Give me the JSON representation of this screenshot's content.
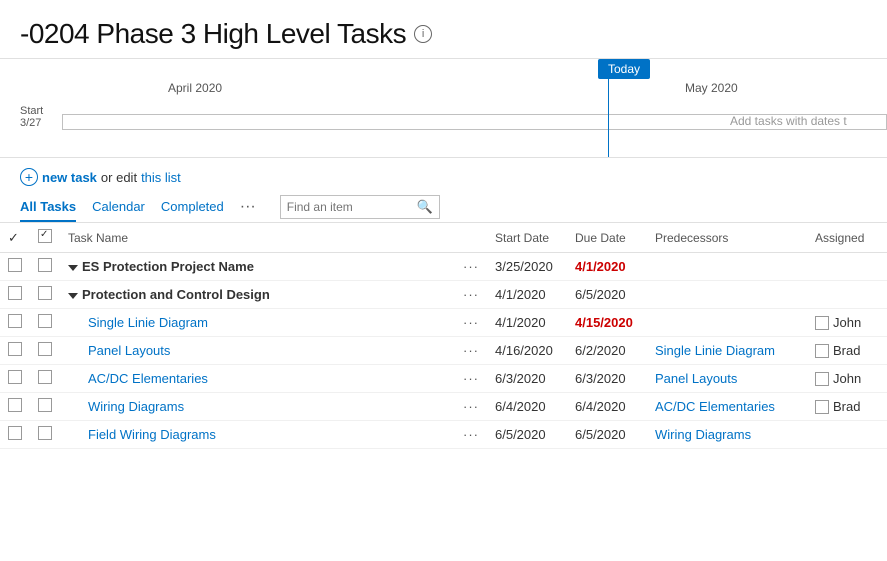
{
  "header": {
    "title": "-0204 Phase 3 High Level Tasks",
    "info_icon": "ⓘ"
  },
  "gantt": {
    "today_label": "Today",
    "april_label": "April 2020",
    "may_label": "May 2020",
    "start_label": "Start",
    "start_date": "3/27",
    "add_tasks_text": "Add tasks with dates t"
  },
  "new_task_bar": {
    "plus": "+",
    "new_task_link": "new task",
    "or_text": " or edit ",
    "edit_link": "this list"
  },
  "tabs": [
    {
      "label": "All Tasks",
      "active": true
    },
    {
      "label": "Calendar",
      "active": false
    },
    {
      "label": "Completed",
      "active": false
    }
  ],
  "tabs_dots": "...",
  "search_placeholder": "Find an item",
  "table": {
    "columns": [
      "",
      "",
      "Task Name",
      "",
      "Start Date",
      "Due Date",
      "Predecessors",
      "Assigned"
    ],
    "rows": [
      {
        "check": "",
        "indent": 1,
        "name": "ES Protection Project Name",
        "name_style": "bold",
        "dots": "···",
        "start": "3/25/2020",
        "start_style": "normal",
        "due": "4/1/2020",
        "due_style": "red",
        "pred": "",
        "assign": ""
      },
      {
        "check": "",
        "indent": 1,
        "name": "Protection and Control Design",
        "name_style": "bold",
        "dots": "···",
        "start": "4/1/2020",
        "start_style": "normal",
        "due": "6/5/2020",
        "due_style": "normal",
        "pred": "",
        "assign": ""
      },
      {
        "check": "",
        "indent": 2,
        "name": "Single Linie Diagram",
        "name_style": "link",
        "dots": "···",
        "start": "4/1/2020",
        "start_style": "normal",
        "due": "4/15/2020",
        "due_style": "red",
        "pred": "",
        "assign": "John"
      },
      {
        "check": "",
        "indent": 2,
        "name": "Panel Layouts",
        "name_style": "link",
        "dots": "···",
        "start": "4/16/2020",
        "start_style": "normal",
        "due": "6/2/2020",
        "due_style": "normal",
        "pred": "Single Linie Diagram",
        "assign": "Brad"
      },
      {
        "check": "",
        "indent": 2,
        "name": "AC/DC Elementaries",
        "name_style": "link",
        "dots": "···",
        "start": "6/3/2020",
        "start_style": "normal",
        "due": "6/3/2020",
        "due_style": "normal",
        "pred": "Panel Layouts",
        "assign": "John"
      },
      {
        "check": "",
        "indent": 2,
        "name": "Wiring Diagrams",
        "name_style": "link",
        "dots": "···",
        "start": "6/4/2020",
        "start_style": "normal",
        "due": "6/4/2020",
        "due_style": "normal",
        "pred": "AC/DC Elementaries",
        "assign": "Brad"
      },
      {
        "check": "",
        "indent": 2,
        "name": "Field Wiring Diagrams",
        "name_style": "link",
        "dots": "···",
        "start": "6/5/2020",
        "start_style": "normal",
        "due": "6/5/2020",
        "due_style": "normal",
        "pred": "Wiring Diagrams",
        "assign": ""
      }
    ]
  },
  "colors": {
    "accent": "#0072c6",
    "red": "#c00000",
    "today_bg": "#0072c6"
  }
}
